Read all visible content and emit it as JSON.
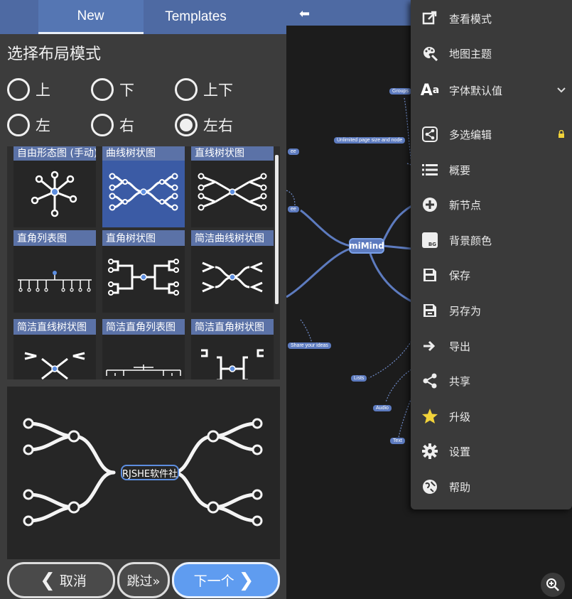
{
  "tabs": [
    {
      "label": "New"
    },
    {
      "label": "Templates"
    }
  ],
  "layout": {
    "title": "选择布局模式",
    "options": [
      {
        "label": "上",
        "selected": false
      },
      {
        "label": "下",
        "selected": false
      },
      {
        "label": "上下",
        "selected": false
      },
      {
        "label": "左",
        "selected": false
      },
      {
        "label": "右",
        "selected": false
      },
      {
        "label": "左右",
        "selected": true
      }
    ]
  },
  "templates": [
    {
      "label": "自由形态图 (手动)",
      "selected": false
    },
    {
      "label": "曲线树状图",
      "selected": true
    },
    {
      "label": "直线树状图",
      "selected": false
    },
    {
      "label": "直角列表图",
      "selected": false
    },
    {
      "label": "直角树状图",
      "selected": false
    },
    {
      "label": "简洁曲线树状图",
      "selected": false
    },
    {
      "label": "简洁直线树状图",
      "selected": false
    },
    {
      "label": "简洁直角列表图",
      "selected": false
    },
    {
      "label": "简洁直角树状图",
      "selected": false
    }
  ],
  "preview": {
    "center_label": "RJSHE软件社"
  },
  "buttons": {
    "cancel": "取消",
    "skip": "跳过»",
    "next": "下一个"
  },
  "mindmap": {
    "center": "miMind",
    "nodes": [
      "Groups",
      "Unlimited page size and node",
      "Share your ideas",
      "Lists",
      "Audio",
      "Text",
      "ee"
    ]
  },
  "menu": {
    "items": [
      {
        "label": "查看模式",
        "icon": "view-mode-icon"
      },
      {
        "label": "地图主题",
        "icon": "palette-icon"
      },
      {
        "label": "字体默认值",
        "icon": "font-icon"
      },
      {
        "label": "多选编辑",
        "icon": "multi-select-icon"
      },
      {
        "label": "概要",
        "icon": "outline-icon"
      },
      {
        "label": "新节点",
        "icon": "add-node-icon"
      },
      {
        "label": "背景颜色",
        "icon": "background-color-icon"
      },
      {
        "label": "保存",
        "icon": "save-icon"
      },
      {
        "label": "另存为",
        "icon": "save-as-icon"
      },
      {
        "label": "导出",
        "icon": "export-icon"
      },
      {
        "label": "共享",
        "icon": "share-icon"
      },
      {
        "label": "升级",
        "icon": "star-icon"
      },
      {
        "label": "设置",
        "icon": "settings-icon"
      },
      {
        "label": "帮助",
        "icon": "help-icon"
      }
    ],
    "bg_badge": "BG"
  },
  "colors": {
    "accent": "#4e6aa3",
    "selected_template": "#3b5ba5",
    "next_button": "#5f9cf0",
    "star": "#f2d33a"
  }
}
